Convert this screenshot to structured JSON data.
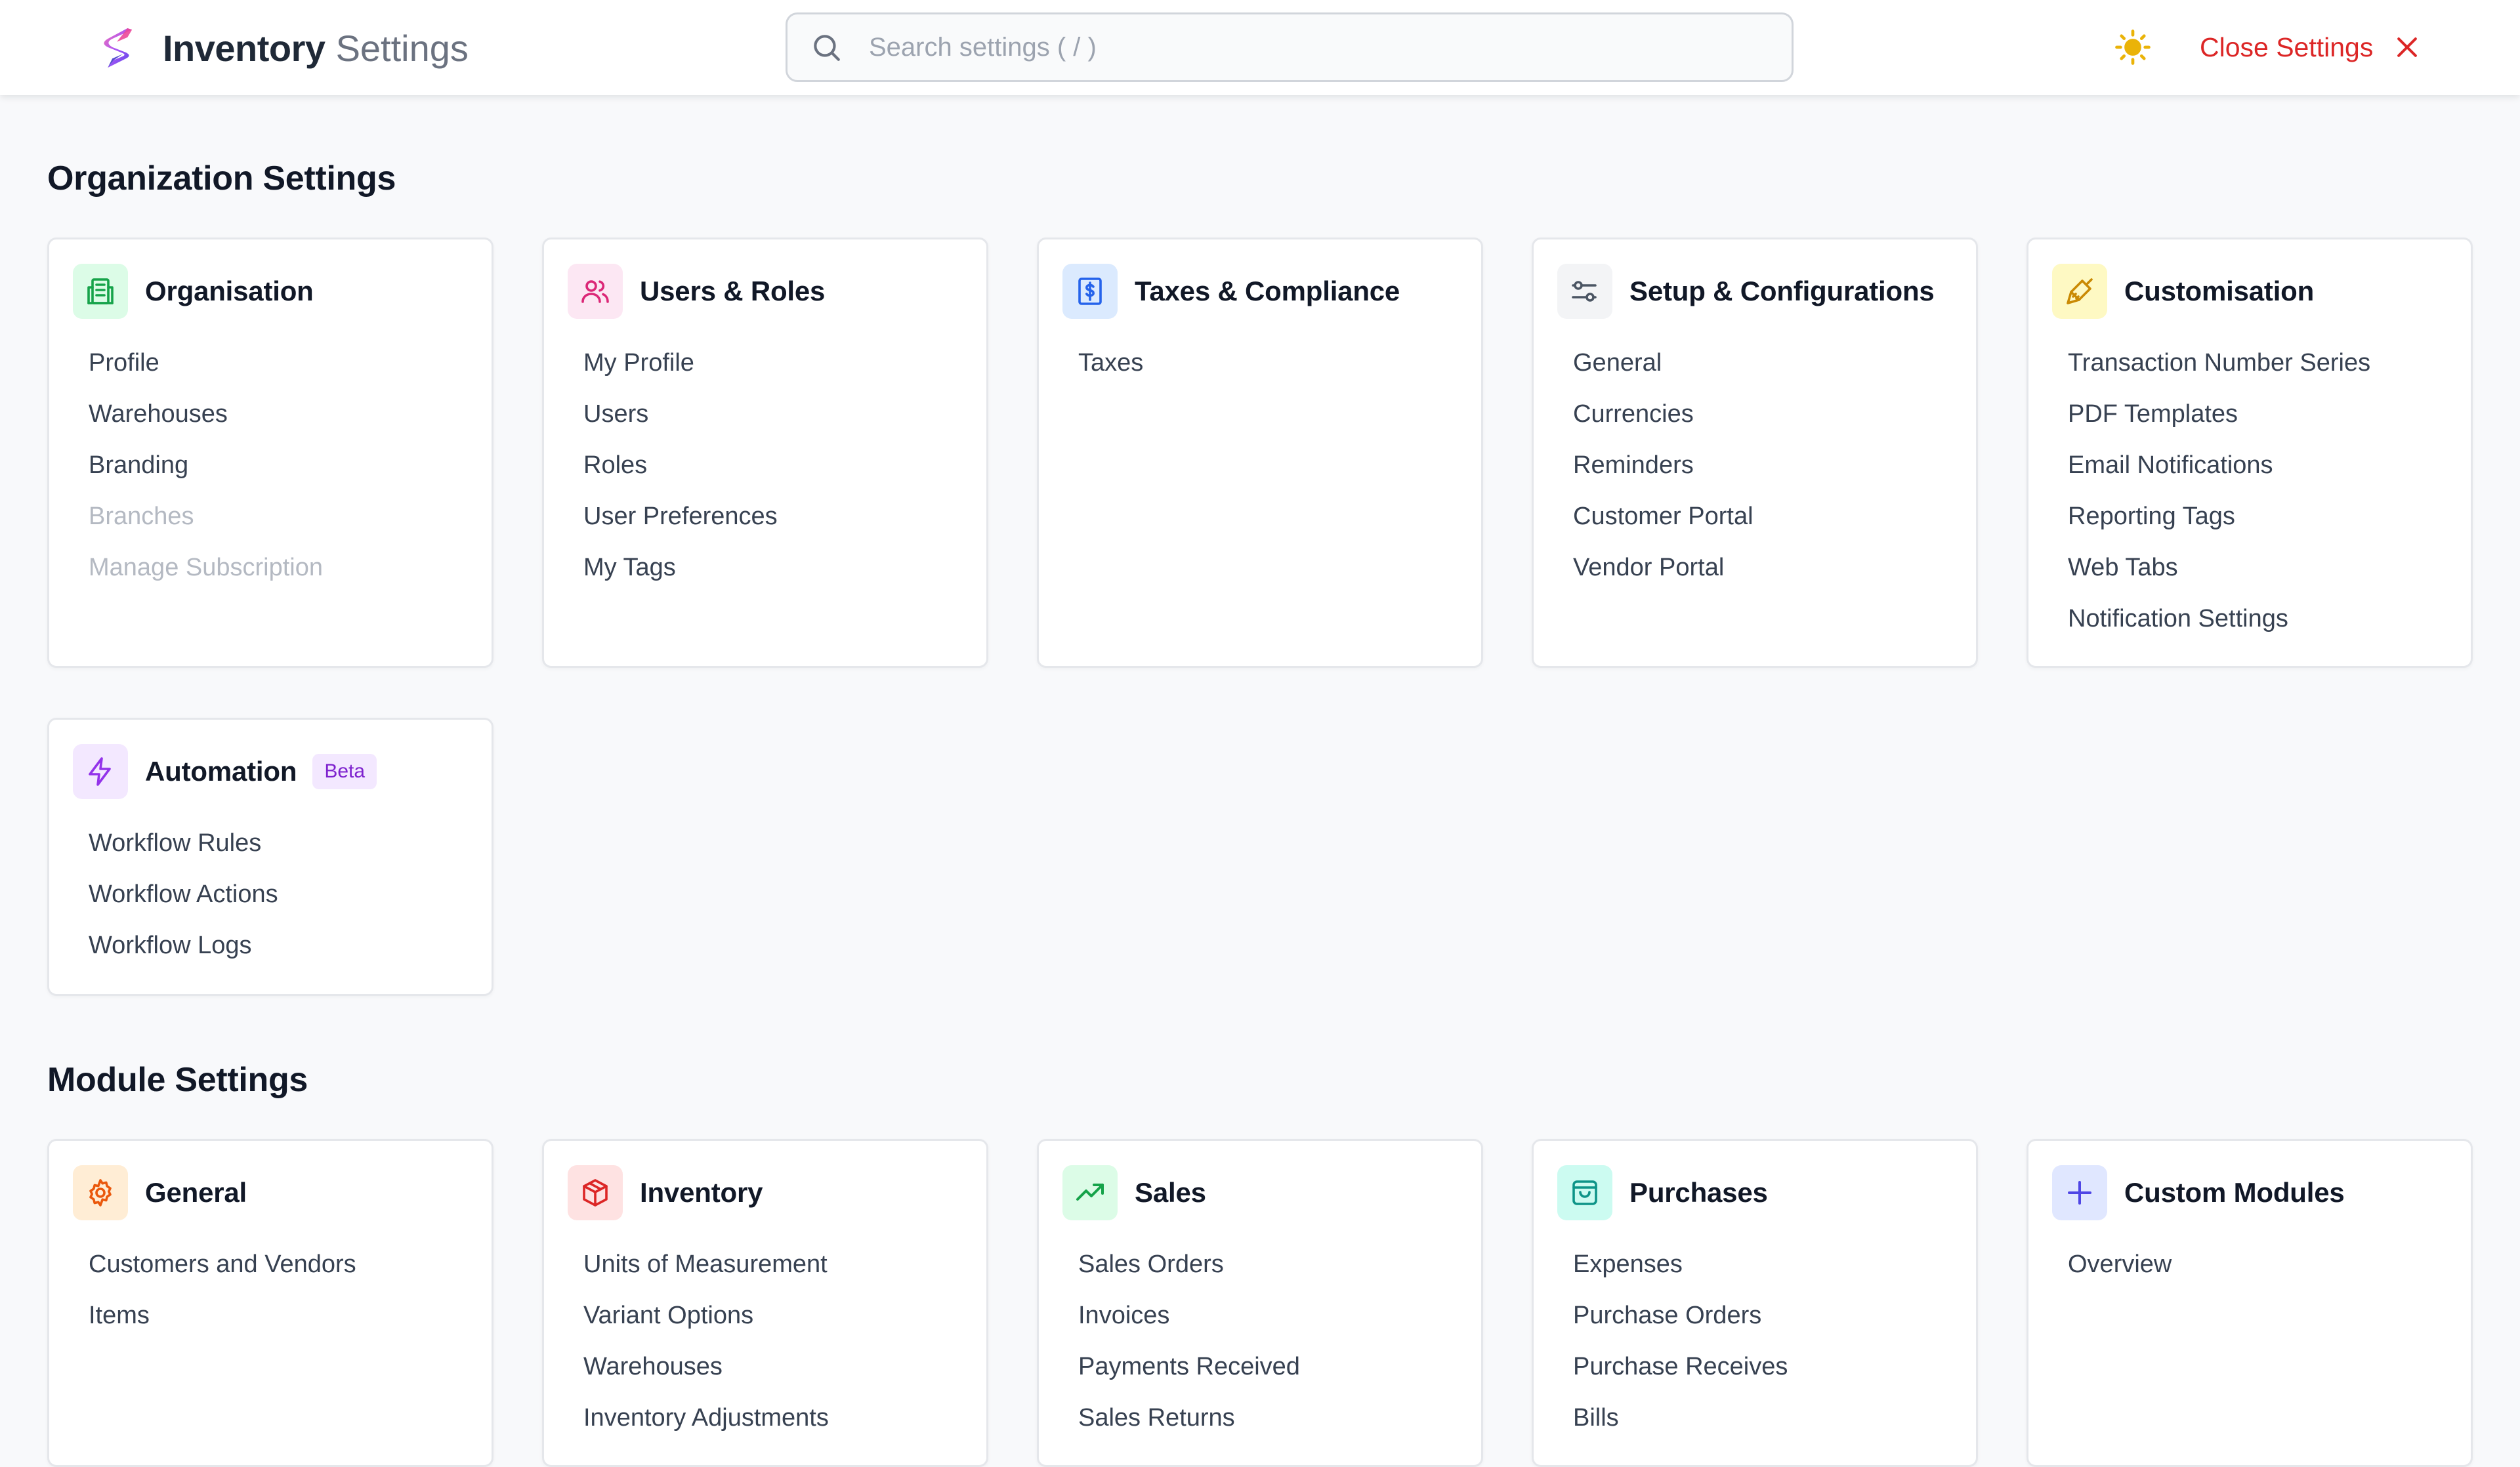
{
  "header": {
    "brand_title": "Inventory",
    "brand_subtitle": "Settings",
    "search_placeholder": "Search settings ( / )",
    "close_label": "Close Settings"
  },
  "colors": {
    "accent_red": "#dc2626",
    "sun_yellow": "#eab308",
    "beta_purple": "#7e22ce"
  },
  "organization": {
    "title": "Organization Settings",
    "cards": [
      {
        "title": "Organisation",
        "icon": "building-icon",
        "links": [
          {
            "label": "Profile",
            "enabled": true
          },
          {
            "label": "Warehouses",
            "enabled": true
          },
          {
            "label": "Branding",
            "enabled": true
          },
          {
            "label": "Branches",
            "enabled": false
          },
          {
            "label": "Manage Subscription",
            "enabled": false
          }
        ]
      },
      {
        "title": "Users & Roles",
        "icon": "users-icon",
        "links": [
          {
            "label": "My Profile",
            "enabled": true
          },
          {
            "label": "Users",
            "enabled": true
          },
          {
            "label": "Roles",
            "enabled": true
          },
          {
            "label": "User Preferences",
            "enabled": true
          },
          {
            "label": "My Tags",
            "enabled": true
          }
        ]
      },
      {
        "title": "Taxes & Compliance",
        "icon": "tax-document-icon",
        "links": [
          {
            "label": "Taxes",
            "enabled": true
          }
        ]
      },
      {
        "title": "Setup & Configurations",
        "icon": "sliders-icon",
        "links": [
          {
            "label": "General",
            "enabled": true
          },
          {
            "label": "Currencies",
            "enabled": true
          },
          {
            "label": "Reminders",
            "enabled": true
          },
          {
            "label": "Customer Portal",
            "enabled": true
          },
          {
            "label": "Vendor Portal",
            "enabled": true
          }
        ]
      },
      {
        "title": "Customisation",
        "icon": "paintbrush-icon",
        "links": [
          {
            "label": "Transaction Number Series",
            "enabled": true
          },
          {
            "label": "PDF Templates",
            "enabled": true
          },
          {
            "label": "Email Notifications",
            "enabled": true
          },
          {
            "label": "Reporting Tags",
            "enabled": true
          },
          {
            "label": "Web Tabs",
            "enabled": true
          },
          {
            "label": "Notification Settings",
            "enabled": true
          }
        ]
      },
      {
        "title": "Automation",
        "icon": "lightning-icon",
        "badge": "Beta",
        "links": [
          {
            "label": "Workflow Rules",
            "enabled": true
          },
          {
            "label": "Workflow Actions",
            "enabled": true
          },
          {
            "label": "Workflow Logs",
            "enabled": true
          }
        ]
      }
    ]
  },
  "modules": {
    "title": "Module Settings",
    "cards": [
      {
        "title": "General",
        "icon": "gear-icon",
        "links": [
          {
            "label": "Customers and Vendors",
            "enabled": true
          },
          {
            "label": "Items",
            "enabled": true
          }
        ]
      },
      {
        "title": "Inventory",
        "icon": "package-icon",
        "links": [
          {
            "label": "Units of Measurement",
            "enabled": true
          },
          {
            "label": "Variant Options",
            "enabled": true
          },
          {
            "label": "Warehouses",
            "enabled": true
          },
          {
            "label": "Inventory Adjustments",
            "enabled": true
          }
        ]
      },
      {
        "title": "Sales",
        "icon": "trending-up-icon",
        "links": [
          {
            "label": "Sales Orders",
            "enabled": true
          },
          {
            "label": "Invoices",
            "enabled": true
          },
          {
            "label": "Payments Received",
            "enabled": true
          },
          {
            "label": "Sales Returns",
            "enabled": true
          }
        ]
      },
      {
        "title": "Purchases",
        "icon": "shopping-bag-icon",
        "links": [
          {
            "label": "Expenses",
            "enabled": true
          },
          {
            "label": "Purchase Orders",
            "enabled": true
          },
          {
            "label": "Purchase Receives",
            "enabled": true
          },
          {
            "label": "Bills",
            "enabled": true
          }
        ]
      },
      {
        "title": "Custom Modules",
        "icon": "plus-icon",
        "links": [
          {
            "label": "Overview",
            "enabled": true
          }
        ]
      }
    ]
  }
}
